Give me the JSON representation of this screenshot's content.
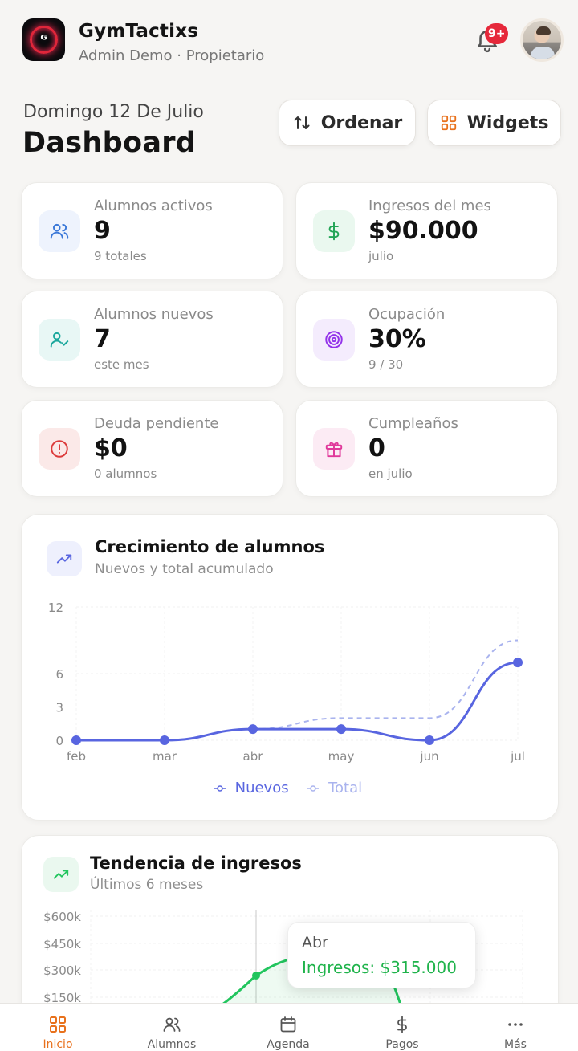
{
  "header": {
    "app_name": "GymTactixs",
    "app_subtitle": "Admin Demo · Propietario",
    "notification_badge": "9+",
    "logo_icon": "gymtactixs-logo",
    "bell_icon": "bell-icon",
    "avatar_icon": "user-avatar"
  },
  "title_row": {
    "date": "Domingo 12 De Julio",
    "title": "Dashboard",
    "sort_label": "Ordenar",
    "widgets_label": "Widgets"
  },
  "stats": [
    {
      "label": "Alumnos activos",
      "value": "9",
      "sub": "9 totales",
      "icon": "users-icon",
      "color": "#3b78d8",
      "bg": "#eef3fd"
    },
    {
      "label": "Ingresos del mes",
      "value": "$90.000",
      "sub": "julio",
      "icon": "dollar-icon",
      "color": "#22a455",
      "bg": "#eaf8ef"
    },
    {
      "label": "Alumnos nuevos",
      "value": "7",
      "sub": "este mes",
      "icon": "user-check-icon",
      "color": "#1aa79c",
      "bg": "#e8f7f5"
    },
    {
      "label": "Ocupación",
      "value": "30%",
      "sub": "9 / 30",
      "icon": "target-icon",
      "color": "#9333ea",
      "bg": "#f4ecfd"
    },
    {
      "label": "Deuda pendiente",
      "value": "$0",
      "sub": "0 alumnos",
      "icon": "alert-circle-icon",
      "color": "#dc3b3b",
      "bg": "#fbe9e8"
    },
    {
      "label": "Cumpleaños",
      "value": "0",
      "sub": "en julio",
      "icon": "gift-icon",
      "color": "#e0389a",
      "bg": "#fcebf4"
    }
  ],
  "growth_card": {
    "title": "Crecimiento de alumnos",
    "subtitle": "Nuevos y total acumulado",
    "icon": "trending-up-icon"
  },
  "revenue_card": {
    "title": "Tendencia de ingresos",
    "subtitle": "Últimos 6 meses",
    "icon": "trending-up-icon",
    "tooltip_title": "Abr",
    "tooltip_value": "Ingresos: $315.000"
  },
  "chart_data": [
    {
      "type": "line",
      "title": "Crecimiento de alumnos",
      "subtitle": "Nuevos y total acumulado",
      "x": [
        "feb",
        "mar",
        "abr",
        "may",
        "jun",
        "jul"
      ],
      "yticks": [
        0,
        3,
        6,
        12
      ],
      "ylim": [
        0,
        12
      ],
      "series": [
        {
          "name": "Nuevos",
          "values": [
            0,
            0,
            1,
            1,
            0,
            7
          ],
          "color": "#5865e0",
          "style": "solid"
        },
        {
          "name": "Total",
          "values": [
            0,
            0,
            1,
            2,
            2,
            9
          ],
          "color": "#a9b3ee",
          "style": "dashed"
        }
      ],
      "legend": "bottom"
    },
    {
      "type": "area",
      "title": "Tendencia de ingresos",
      "subtitle": "Últimos 6 meses",
      "yticks": [
        "$600k",
        "$450k",
        "$300k",
        "$150k"
      ],
      "ylim": [
        0,
        600000
      ],
      "series": [
        {
          "name": "Ingresos",
          "color": "#22c55e"
        }
      ],
      "highlight": {
        "x": "Abr",
        "value": 315000
      }
    }
  ],
  "bottom_nav": [
    {
      "label": "Inicio",
      "icon": "grid-icon",
      "active": true
    },
    {
      "label": "Alumnos",
      "icon": "users-icon",
      "active": false
    },
    {
      "label": "Agenda",
      "icon": "calendar-icon",
      "active": false
    },
    {
      "label": "Pagos",
      "icon": "dollar-icon",
      "active": false
    },
    {
      "label": "Más",
      "icon": "more-icon",
      "active": false
    }
  ]
}
